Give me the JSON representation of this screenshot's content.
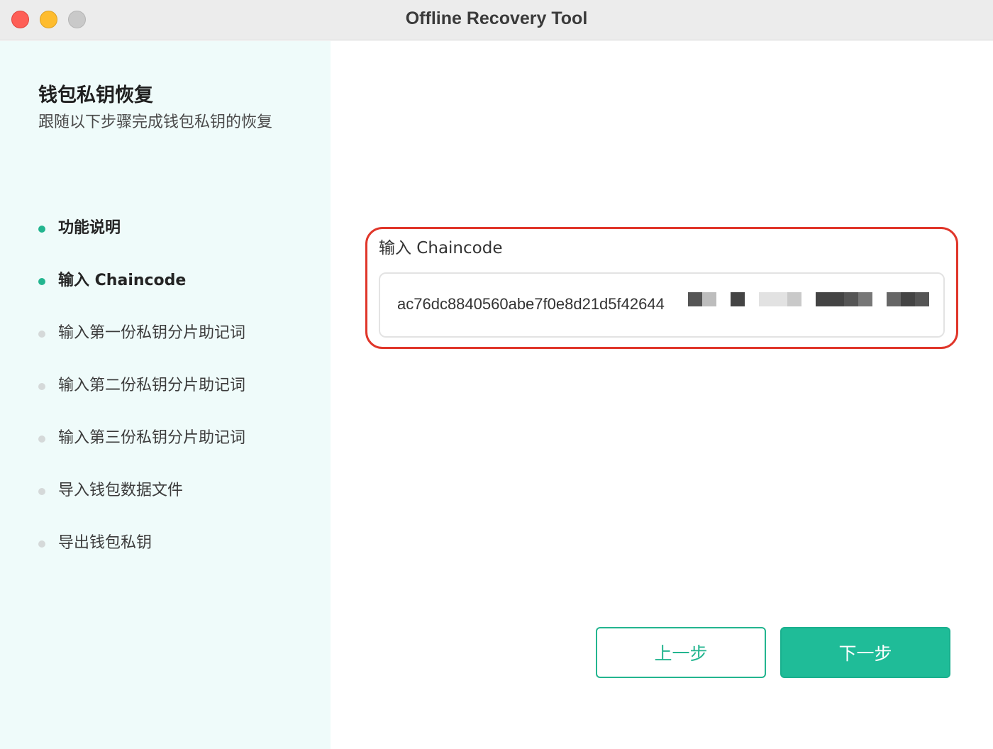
{
  "window": {
    "title": "Offline Recovery Tool"
  },
  "sidebar": {
    "title": "钱包私钥恢复",
    "subtitle": "跟随以下步骤完成钱包私钥的恢复",
    "steps": [
      {
        "label": "功能说明",
        "status": "done"
      },
      {
        "label": "输入 Chaincode",
        "status": "done"
      },
      {
        "label": "输入第一份私钥分片助记词",
        "status": "pending"
      },
      {
        "label": "输入第二份私钥分片助记词",
        "status": "pending"
      },
      {
        "label": "输入第三份私钥分片助记词",
        "status": "pending"
      },
      {
        "label": "导入钱包数据文件",
        "status": "pending"
      },
      {
        "label": "导出钱包私钥",
        "status": "pending"
      }
    ]
  },
  "main": {
    "field_label": "输入 Chaincode",
    "chaincode_value": "ac76dc8840560abe7f0e8d21d5f42644"
  },
  "buttons": {
    "prev": "上一步",
    "next": "下一步"
  },
  "colors": {
    "accent": "#1fbc98",
    "highlight": "#e0362a",
    "sidebar_bg": "#effbfa"
  }
}
